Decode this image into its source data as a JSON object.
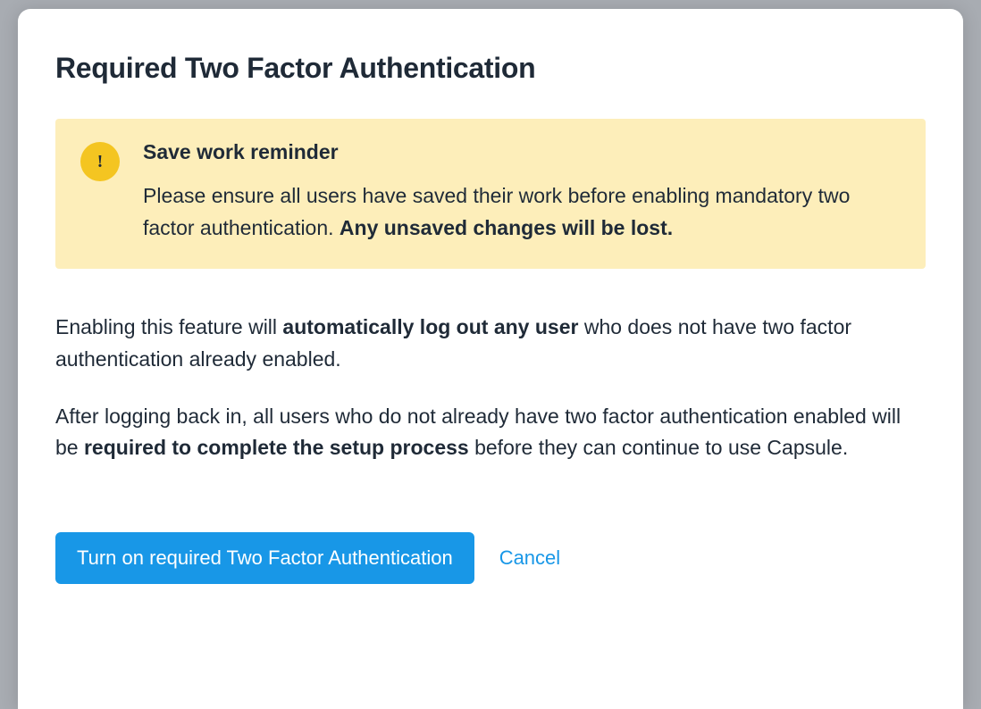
{
  "modal": {
    "title": "Required Two Factor Authentication",
    "alert": {
      "icon_glyph": "!",
      "title": "Save work reminder",
      "text_before_bold": "Please ensure all users have saved their work before enabling mandatory two factor authentication. ",
      "text_bold": "Any unsaved changes will be lost."
    },
    "para1_before": "Enabling this feature will ",
    "para1_bold": "automatically log out any user",
    "para1_after": " who does not have two factor authentication already enabled.",
    "para2_before": "After logging back in, all users who do not already have two factor authentication enabled will be ",
    "para2_bold": "required to complete the setup process",
    "para2_after": " before they can continue to use Capsule.",
    "buttons": {
      "confirm": "Turn on required Two Factor Authentication",
      "cancel": "Cancel"
    }
  }
}
